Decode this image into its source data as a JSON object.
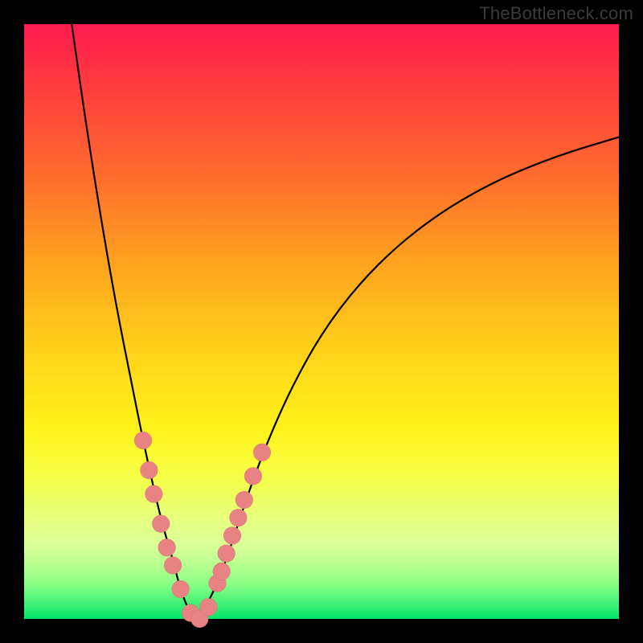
{
  "watermark": {
    "text": "TheBottleneck.com"
  },
  "colors": {
    "marker": "#e98282",
    "curve": "#000000",
    "gradient_top": "#ff1a4f",
    "gradient_bottom": "#00e66a",
    "frame": "#000000"
  },
  "chart_data": {
    "type": "line",
    "title": "",
    "xlabel": "",
    "ylabel": "",
    "xlim": [
      0,
      100
    ],
    "ylim": [
      0,
      100
    ],
    "grid": false,
    "legend": false,
    "series": [
      {
        "name": "curve-left",
        "x": [
          8,
          10,
          12,
          14,
          16,
          18,
          20,
          22,
          23.5,
          25,
          26,
          27,
          28,
          29
        ],
        "y": [
          100,
          86,
          73,
          61,
          50,
          40,
          30,
          21,
          15,
          10,
          6,
          3,
          1,
          0
        ]
      },
      {
        "name": "curve-right",
        "x": [
          29,
          30,
          31,
          32.5,
          34,
          36,
          38,
          41,
          45,
          50,
          56,
          63,
          71,
          80,
          90,
          100
        ],
        "y": [
          0,
          1,
          3,
          6,
          10,
          16,
          22,
          30,
          39,
          48,
          56,
          63,
          69,
          74,
          78,
          81
        ]
      }
    ],
    "markers": {
      "name": "highlight-points",
      "x": [
        20.0,
        21.0,
        21.8,
        23.0,
        24.0,
        25.0,
        26.3,
        28.0,
        29.5,
        31.0,
        32.5,
        33.2,
        34.0,
        35.0,
        36.0,
        37.0,
        38.5,
        40.0
      ],
      "y": [
        30,
        25,
        21,
        16,
        12,
        9,
        5,
        1,
        0,
        2,
        6,
        8,
        11,
        14,
        17,
        20,
        24,
        28
      ],
      "size": 11
    }
  }
}
